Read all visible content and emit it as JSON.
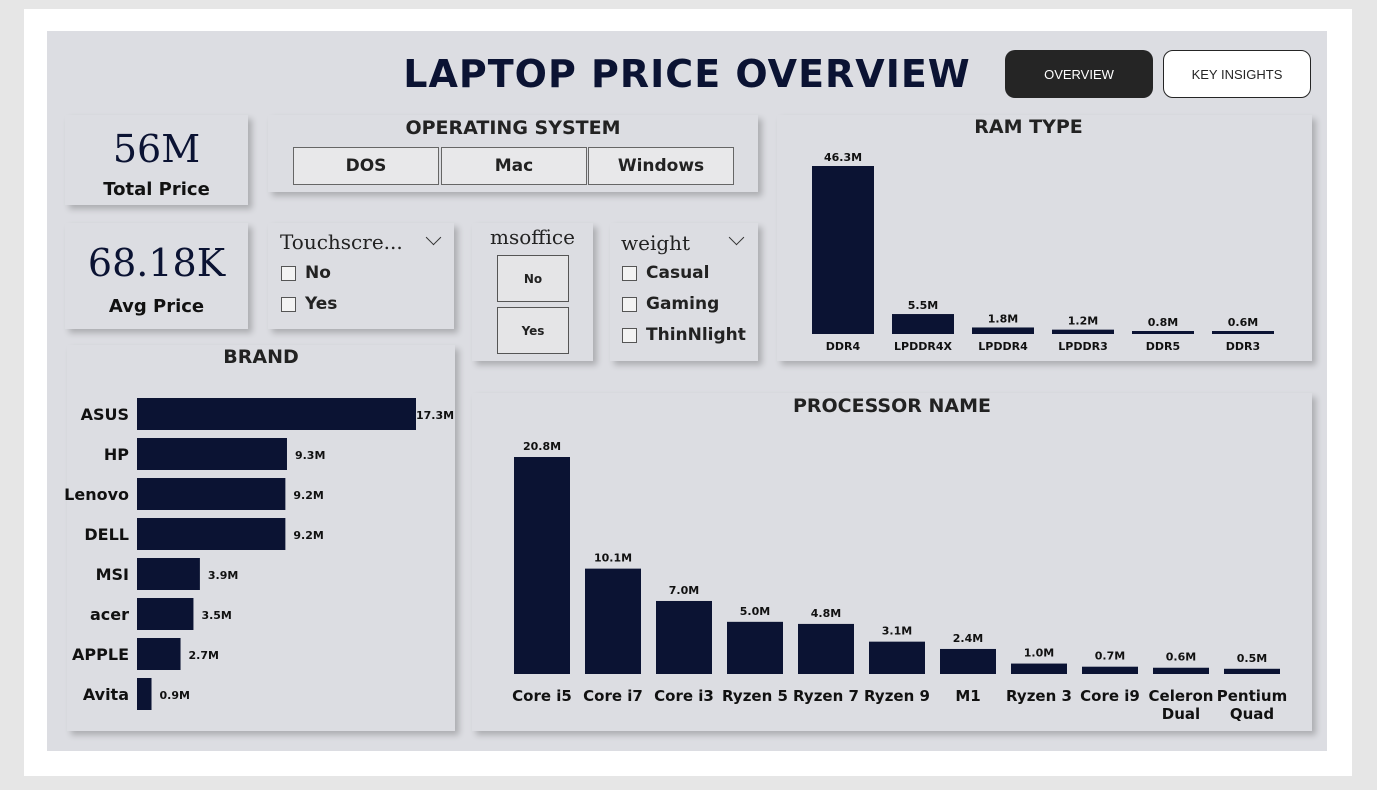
{
  "header": {
    "title": "LAPTOP PRICE OVERVIEW"
  },
  "nav": {
    "overview_label": "OVERVIEW",
    "insights_label": "KEY INSIGHTS"
  },
  "kpis": {
    "total": {
      "value": "56M",
      "label": "Total Price"
    },
    "avg": {
      "value": "68.18K",
      "label": "Avg Price"
    }
  },
  "os_slicer": {
    "title": "OPERATING SYSTEM",
    "options": [
      "DOS",
      "Mac",
      "Windows"
    ]
  },
  "touch_slicer": {
    "title": "Touchscre...",
    "options": [
      "No",
      "Yes"
    ]
  },
  "msoffice_slicer": {
    "title": "msoffice",
    "options": [
      "No",
      "Yes"
    ]
  },
  "weight_slicer": {
    "title": "weight",
    "options": [
      "Casual",
      "Gaming",
      "ThinNlight"
    ]
  },
  "colors": {
    "bar": "#0b1333",
    "panel": "#dcdde2",
    "active_nav": "#252525"
  },
  "chart_data": [
    {
      "id": "brand",
      "type": "bar",
      "orientation": "horizontal",
      "title": "BRAND",
      "categories": [
        "ASUS",
        "HP",
        "Lenovo",
        "DELL",
        "MSI",
        "acer",
        "APPLE",
        "Avita"
      ],
      "values": [
        17.3,
        9.3,
        9.2,
        9.2,
        3.9,
        3.5,
        2.7,
        0.9
      ],
      "labels": [
        "17.3M",
        "9.3M",
        "9.2M",
        "9.2M",
        "3.9M",
        "3.5M",
        "2.7M",
        "0.9M"
      ],
      "unit": "M"
    },
    {
      "id": "ram",
      "type": "bar",
      "title": "RAM TYPE",
      "categories": [
        "DDR4",
        "LPDDR4X",
        "LPDDR4",
        "LPDDR3",
        "DDR5",
        "DDR3"
      ],
      "values": [
        46.3,
        5.5,
        1.8,
        1.2,
        0.8,
        0.6
      ],
      "labels": [
        "46.3M",
        "5.5M",
        "1.8M",
        "1.2M",
        "0.8M",
        "0.6M"
      ],
      "unit": "M"
    },
    {
      "id": "processor",
      "type": "bar",
      "title": "PROCESSOR NAME",
      "categories": [
        [
          "Core i5"
        ],
        [
          "Core i7"
        ],
        [
          "Core i3"
        ],
        [
          "Ryzen 5"
        ],
        [
          "Ryzen 7"
        ],
        [
          "Ryzen 9"
        ],
        [
          "M1"
        ],
        [
          "Ryzen 3"
        ],
        [
          "Core i9"
        ],
        [
          "Celeron",
          "Dual"
        ],
        [
          "Pentium",
          "Quad"
        ]
      ],
      "values": [
        20.8,
        10.1,
        7.0,
        5.0,
        4.8,
        3.1,
        2.4,
        1.0,
        0.7,
        0.6,
        0.5
      ],
      "labels": [
        "20.8M",
        "10.1M",
        "7.0M",
        "5.0M",
        "4.8M",
        "3.1M",
        "2.4M",
        "1.0M",
        "0.7M",
        "0.6M",
        "0.5M"
      ],
      "unit": "M"
    }
  ]
}
